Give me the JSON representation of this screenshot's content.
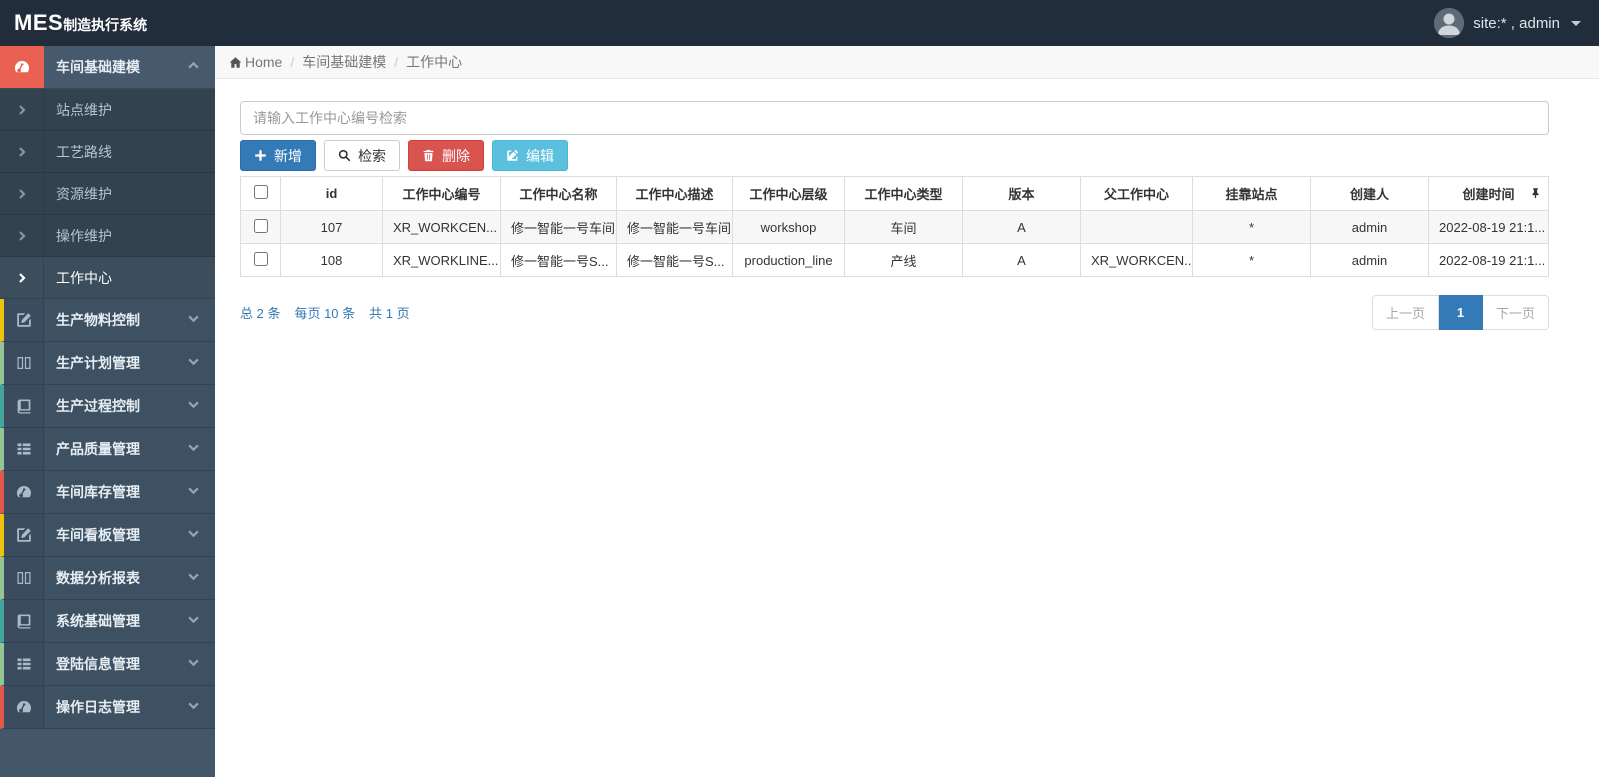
{
  "topbar": {
    "brand_mes": "MES",
    "brand_suffix": "制造执行系统",
    "user": "site:* , admin"
  },
  "breadcrumb": {
    "home": "Home",
    "separator": "/",
    "section": "车间基础建模",
    "current": "工作中心"
  },
  "sidebar": {
    "items": [
      {
        "label": "车间基础建模",
        "icon": "gauge-icon",
        "state": "expanded"
      },
      {
        "label": "生产物料控制",
        "icon": "edit-square-icon",
        "accent": "#efc20e"
      },
      {
        "label": "生产计划管理",
        "icon": "columns-icon",
        "accent": "#94c695"
      },
      {
        "label": "生产过程控制",
        "icon": "book-icon",
        "accent": "#43a5a0"
      },
      {
        "label": "产品质量管理",
        "icon": "list-icon",
        "accent": "#94c695"
      },
      {
        "label": "车间库存管理",
        "icon": "gauge-icon",
        "accent": "#e2574c"
      },
      {
        "label": "车间看板管理",
        "icon": "edit-square-icon",
        "accent": "#efc20e"
      },
      {
        "label": "数据分析报表",
        "icon": "columns-icon",
        "accent": "#94c695"
      },
      {
        "label": "系统基础管理",
        "icon": "book-icon",
        "accent": "#43a5a0"
      },
      {
        "label": "登陆信息管理",
        "icon": "list-icon",
        "accent": "#94c695"
      },
      {
        "label": "操作日志管理",
        "icon": "gauge-icon",
        "accent": "#e2574c"
      }
    ],
    "sub_items": [
      {
        "label": "站点维护"
      },
      {
        "label": "工艺路线"
      },
      {
        "label": "资源维护"
      },
      {
        "label": "操作维护"
      },
      {
        "label": "工作中心",
        "active": true
      }
    ]
  },
  "search": {
    "placeholder": "请输入工作中心编号检索"
  },
  "toolbar": {
    "add": "新增",
    "search": "检索",
    "delete": "删除",
    "edit": "编辑"
  },
  "table": {
    "columns": [
      "id",
      "工作中心编号",
      "工作中心名称",
      "工作中心描述",
      "工作中心层级",
      "工作中心类型",
      "版本",
      "父工作中心",
      "挂靠站点",
      "创建人",
      "创建时间"
    ],
    "rows": [
      {
        "cells": [
          "107",
          "XR_WORKCEN...",
          "修一智能一号车间",
          "修一智能一号车间",
          "workshop",
          "车间",
          "A",
          "",
          "*",
          "admin",
          "2022-08-19 21:1..."
        ]
      },
      {
        "cells": [
          "108",
          "XR_WORKLINE...",
          "修一智能一号S...",
          "修一智能一号S...",
          "production_line",
          "产线",
          "A",
          "XR_WORKCEN...",
          "*",
          "admin",
          "2022-08-19 21:1..."
        ]
      }
    ]
  },
  "summary": {
    "total": "总 2 条",
    "per_page": "每页 10 条",
    "pages": "共 1 页"
  },
  "pagination": {
    "prev": "上一页",
    "current": "1",
    "next": "下一页"
  },
  "colors": {
    "topbar_bg": "#222d3b",
    "sidebar_bg": "#445669",
    "brand_icon_bg": "#ea6153",
    "primary": "#337ab7",
    "danger": "#d9534f",
    "info": "#5bc0de",
    "stripe_row": "#f7f7f7"
  }
}
